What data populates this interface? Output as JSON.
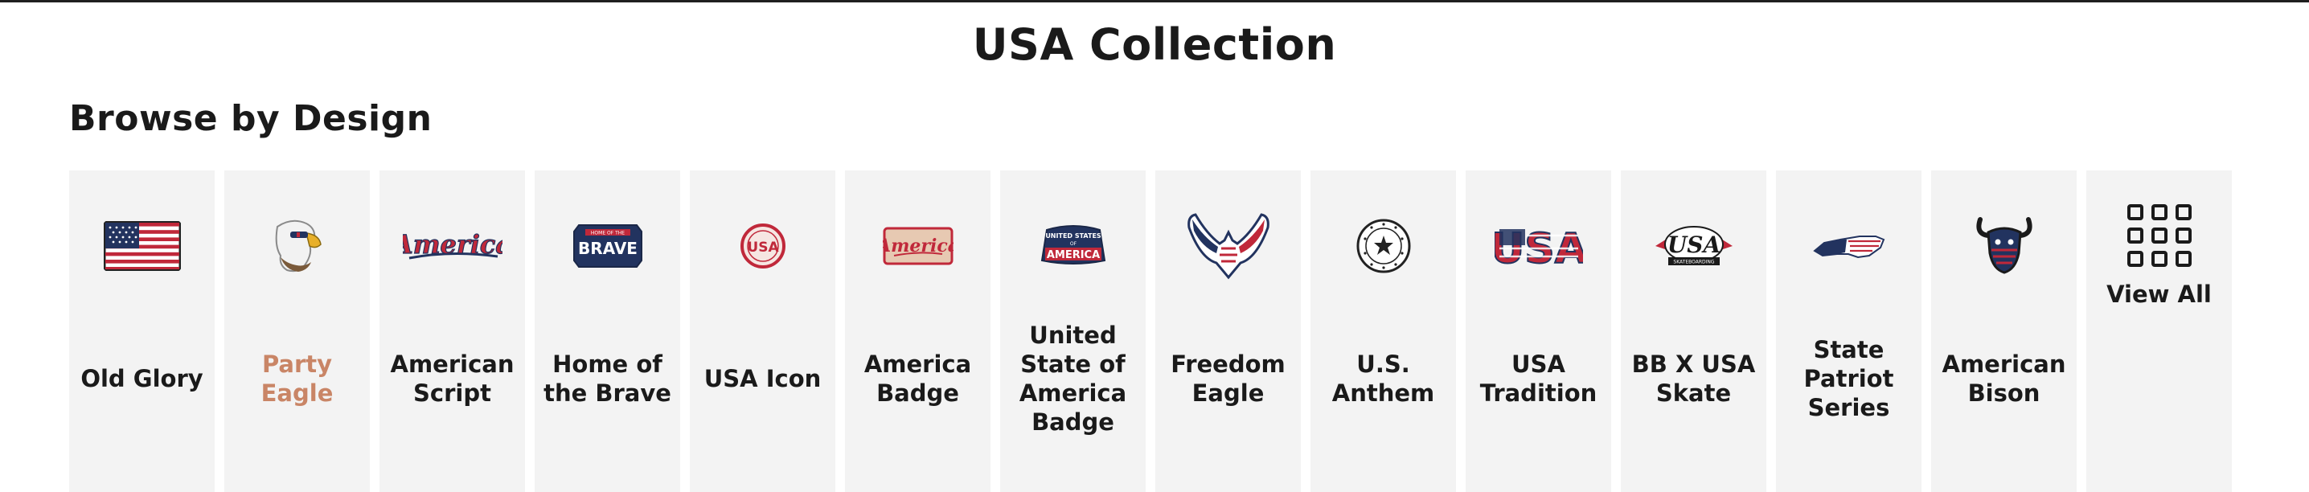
{
  "page": {
    "title": "USA Collection"
  },
  "section": {
    "title": "Browse by Design"
  },
  "colors": {
    "highlight_label": "#c98566",
    "tile_bg": "#f3f3f3",
    "navy": "#22335f",
    "red": "#c0283a"
  },
  "designs": [
    {
      "label": "Old Glory",
      "icon": "us-flag-icon"
    },
    {
      "label": "Party Eagle",
      "icon": "eagle-head-icon",
      "highlighted": true
    },
    {
      "label": "American Script",
      "icon": "america-script-icon"
    },
    {
      "label": "Home of the Brave",
      "icon": "brave-badge-icon"
    },
    {
      "label": "USA Icon",
      "icon": "usa-circle-icon"
    },
    {
      "label": "America Badge",
      "icon": "america-badge-icon"
    },
    {
      "label": "United State of America Badge",
      "icon": "usa-banner-badge-icon"
    },
    {
      "label": "Freedom Eagle",
      "icon": "flag-eagle-icon"
    },
    {
      "label": "U.S. Anthem",
      "icon": "anthem-seal-icon"
    },
    {
      "label": "USA Tradition",
      "icon": "usa-flag-letters-icon"
    },
    {
      "label": "BB X USA Skate",
      "icon": "skate-logo-icon"
    },
    {
      "label": "State Patriot Series",
      "icon": "state-outline-icon"
    },
    {
      "label": "American Bison",
      "icon": "bison-skull-icon"
    }
  ],
  "view_all": {
    "label": "View All",
    "icon": "grid-icon"
  },
  "icon_text": {
    "america": "America",
    "home_of_the": "HOME OF THE",
    "brave": "BRAVE",
    "usa": "USA",
    "united_states": "UNITED STATES",
    "of": "OF",
    "america_caps": "AMERICA",
    "skateboarding": "SKATEBOARDING"
  }
}
